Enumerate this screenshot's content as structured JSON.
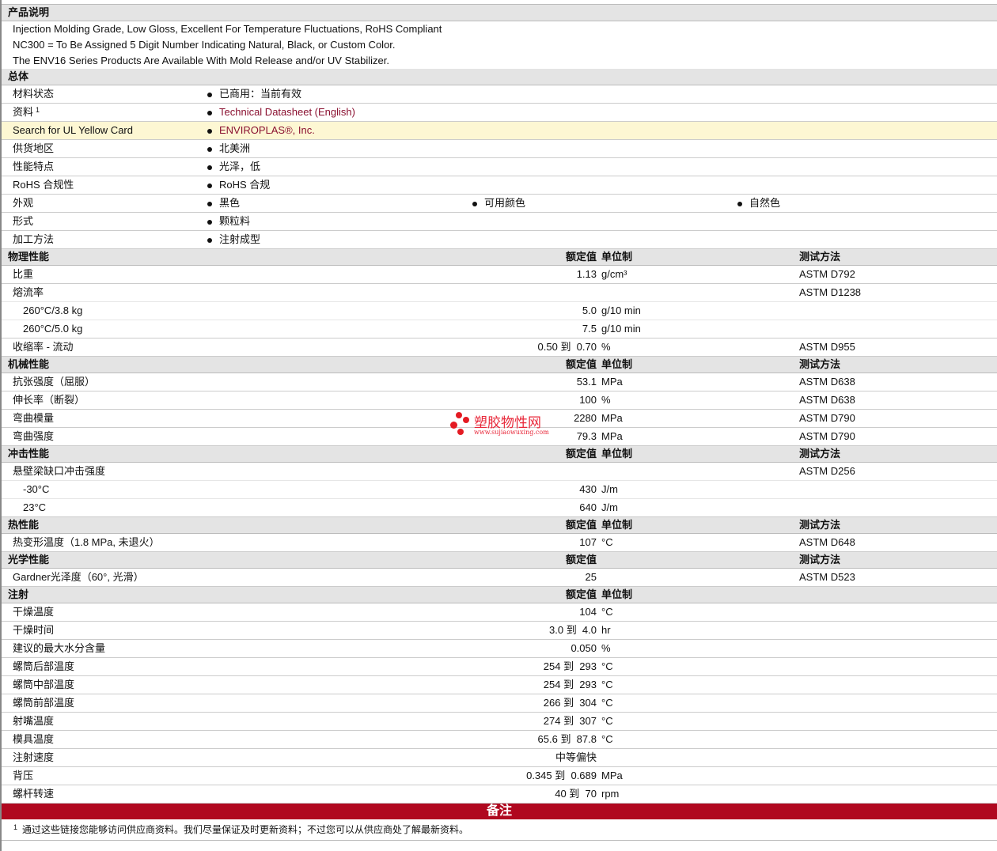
{
  "description": {
    "title": "产品说明",
    "lines": [
      "Injection Molding Grade, Low Gloss, Excellent For Temperature Fluctuations, RoHS Compliant",
      "NC300 = To Be Assigned 5 Digit Number Indicating Natural, Black, or Custom Color.",
      "The ENV16 Series Products Are Available With Mold Release and/or UV Stabilizer."
    ]
  },
  "general": {
    "title": "总体",
    "rows": [
      {
        "label": "材料状态",
        "values": [
          "已商用：当前有效"
        ]
      },
      {
        "label": "资料",
        "sup": "1",
        "values": [
          "Technical Datasheet (English)"
        ],
        "link": true
      },
      {
        "label": "Search for UL Yellow Card",
        "values": [
          "ENVIROPLAS®, Inc."
        ],
        "link": true,
        "highlight": true
      },
      {
        "label": "供货地区",
        "values": [
          "北美洲"
        ]
      },
      {
        "label": "性能特点",
        "values": [
          "光泽，低"
        ]
      },
      {
        "label": "RoHS 合规性",
        "values": [
          "RoHS 合规"
        ]
      },
      {
        "label": "外观",
        "values": [
          "黑色",
          "可用颜色",
          "自然色"
        ]
      },
      {
        "label": "形式",
        "values": [
          "颗粒料"
        ]
      },
      {
        "label": "加工方法",
        "values": [
          "注射成型"
        ]
      }
    ]
  },
  "sections": [
    {
      "title": "物理性能",
      "nominal": "额定值",
      "unit": "单位制",
      "method": "测试方法",
      "rows": [
        {
          "label": "比重",
          "value": "1.13",
          "unit": "g/cm³",
          "method": "ASTM D792"
        },
        {
          "label": "熔流率",
          "value": "",
          "unit": "",
          "method": "ASTM D1238",
          "sub": true
        },
        {
          "label": "260°C/3.8 kg",
          "value": "5.0",
          "unit": "g/10 min",
          "method": "",
          "indent": true,
          "sub": true
        },
        {
          "label": "260°C/5.0 kg",
          "value": "7.5",
          "unit": "g/10 min",
          "method": "",
          "indent": true
        },
        {
          "label": "收缩率 - 流动",
          "value": "0.50 到  0.70",
          "unit": "%",
          "method": "ASTM D955"
        }
      ]
    },
    {
      "title": "机械性能",
      "nominal": "额定值",
      "unit": "单位制",
      "method": "测试方法",
      "rows": [
        {
          "label": "抗张强度（屈服）",
          "value": "53.1",
          "unit": "MPa",
          "method": "ASTM D638"
        },
        {
          "label": "伸长率（断裂）",
          "value": "100",
          "unit": "%",
          "method": "ASTM D638"
        },
        {
          "label": "弯曲模量",
          "value": "2280",
          "unit": "MPa",
          "method": "ASTM D790"
        },
        {
          "label": "弯曲强度",
          "value": "79.3",
          "unit": "MPa",
          "method": "ASTM D790"
        }
      ]
    },
    {
      "title": "冲击性能",
      "nominal": "额定值",
      "unit": "单位制",
      "method": "测试方法",
      "rows": [
        {
          "label": "悬壁梁缺口冲击强度",
          "value": "",
          "unit": "",
          "method": "ASTM D256",
          "sub": true
        },
        {
          "label": "-30°C",
          "value": "430",
          "unit": "J/m",
          "method": "",
          "indent": true,
          "sub": true
        },
        {
          "label": "23°C",
          "value": "640",
          "unit": "J/m",
          "method": "",
          "indent": true
        }
      ]
    },
    {
      "title": "热性能",
      "nominal": "额定值",
      "unit": "单位制",
      "method": "测试方法",
      "rows": [
        {
          "label": "热变形温度（1.8 MPa, 未退火）",
          "value": "107",
          "unit": "°C",
          "method": "ASTM D648"
        }
      ]
    },
    {
      "title": "光学性能",
      "nominal": "额定值",
      "unit": "",
      "method": "测试方法",
      "rows": [
        {
          "label": "Gardner光泽度（60°, 光滑）",
          "value": "25",
          "unit": "",
          "method": "ASTM D523"
        }
      ]
    },
    {
      "title": "注射",
      "nominal": "额定值",
      "unit": "单位制",
      "method": "",
      "rows": [
        {
          "label": "干燥温度",
          "value": "104",
          "unit": "°C",
          "method": ""
        },
        {
          "label": "干燥时间",
          "value": "3.0 到  4.0",
          "unit": "hr",
          "method": ""
        },
        {
          "label": "建议的最大水分含量",
          "value": "0.050",
          "unit": "%",
          "method": ""
        },
        {
          "label": "螺筒后部温度",
          "value": "254 到  293",
          "unit": "°C",
          "method": ""
        },
        {
          "label": "螺筒中部温度",
          "value": "254 到  293",
          "unit": "°C",
          "method": ""
        },
        {
          "label": "螺筒前部温度",
          "value": "266 到  304",
          "unit": "°C",
          "method": ""
        },
        {
          "label": "射嘴温度",
          "value": "274 到  307",
          "unit": "°C",
          "method": ""
        },
        {
          "label": "模具温度",
          "value": "65.6 到  87.8",
          "unit": "°C",
          "method": ""
        },
        {
          "label": "注射速度",
          "value": "中等偏快",
          "unit": "",
          "method": ""
        },
        {
          "label": "背压",
          "value": "0.345 到  0.689",
          "unit": "MPa",
          "method": ""
        },
        {
          "label": "螺杆转速",
          "value": "40 到  70",
          "unit": "rpm",
          "method": ""
        }
      ]
    }
  ],
  "notes": {
    "title": "备注",
    "sup": "1",
    "text": "通过这些链接您能够访问供应商资料。我们尽量保证及时更新资料；不过您可以从供应商处了解最新资料。"
  },
  "watermark": {
    "name": "塑胶物性网",
    "url": "www.sujiaowuxing.com"
  }
}
